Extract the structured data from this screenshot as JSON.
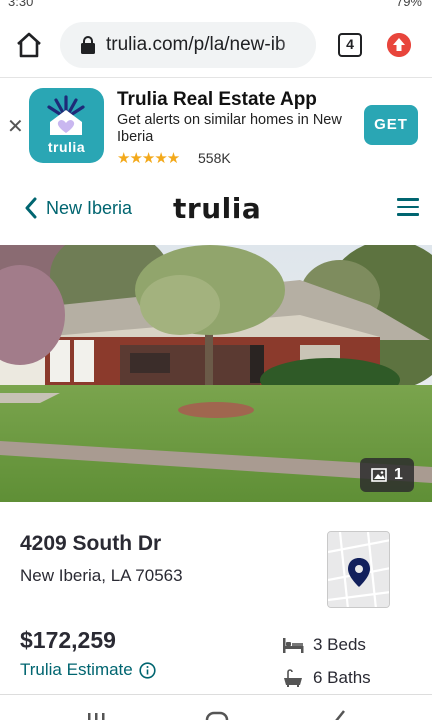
{
  "status_bar": {
    "time": "3:30",
    "battery": "79%"
  },
  "browser": {
    "url": "trulia.com/p/la/new-ib",
    "tab_count": "4"
  },
  "app_banner": {
    "title": "Trulia Real Estate App",
    "subtitle": "Get alerts on similar homes in New Iberia",
    "icon_label": "trulia",
    "stars": "★★★★★",
    "rating_count": "558K",
    "get_label": "GET"
  },
  "header": {
    "back_label": "New Iberia",
    "logo": "trulia"
  },
  "photo": {
    "count": "1"
  },
  "listing": {
    "address": "4209 South Dr",
    "city": "New Iberia, LA 70563",
    "price": "$172,259",
    "estimate_label": "Trulia Estimate",
    "beds": "3 Beds",
    "baths": "6 Baths"
  },
  "colors": {
    "brand_teal": "#2aa6b4",
    "link_teal": "#006570",
    "star_gold": "#f3a91b",
    "update_red": "#e8453c"
  }
}
